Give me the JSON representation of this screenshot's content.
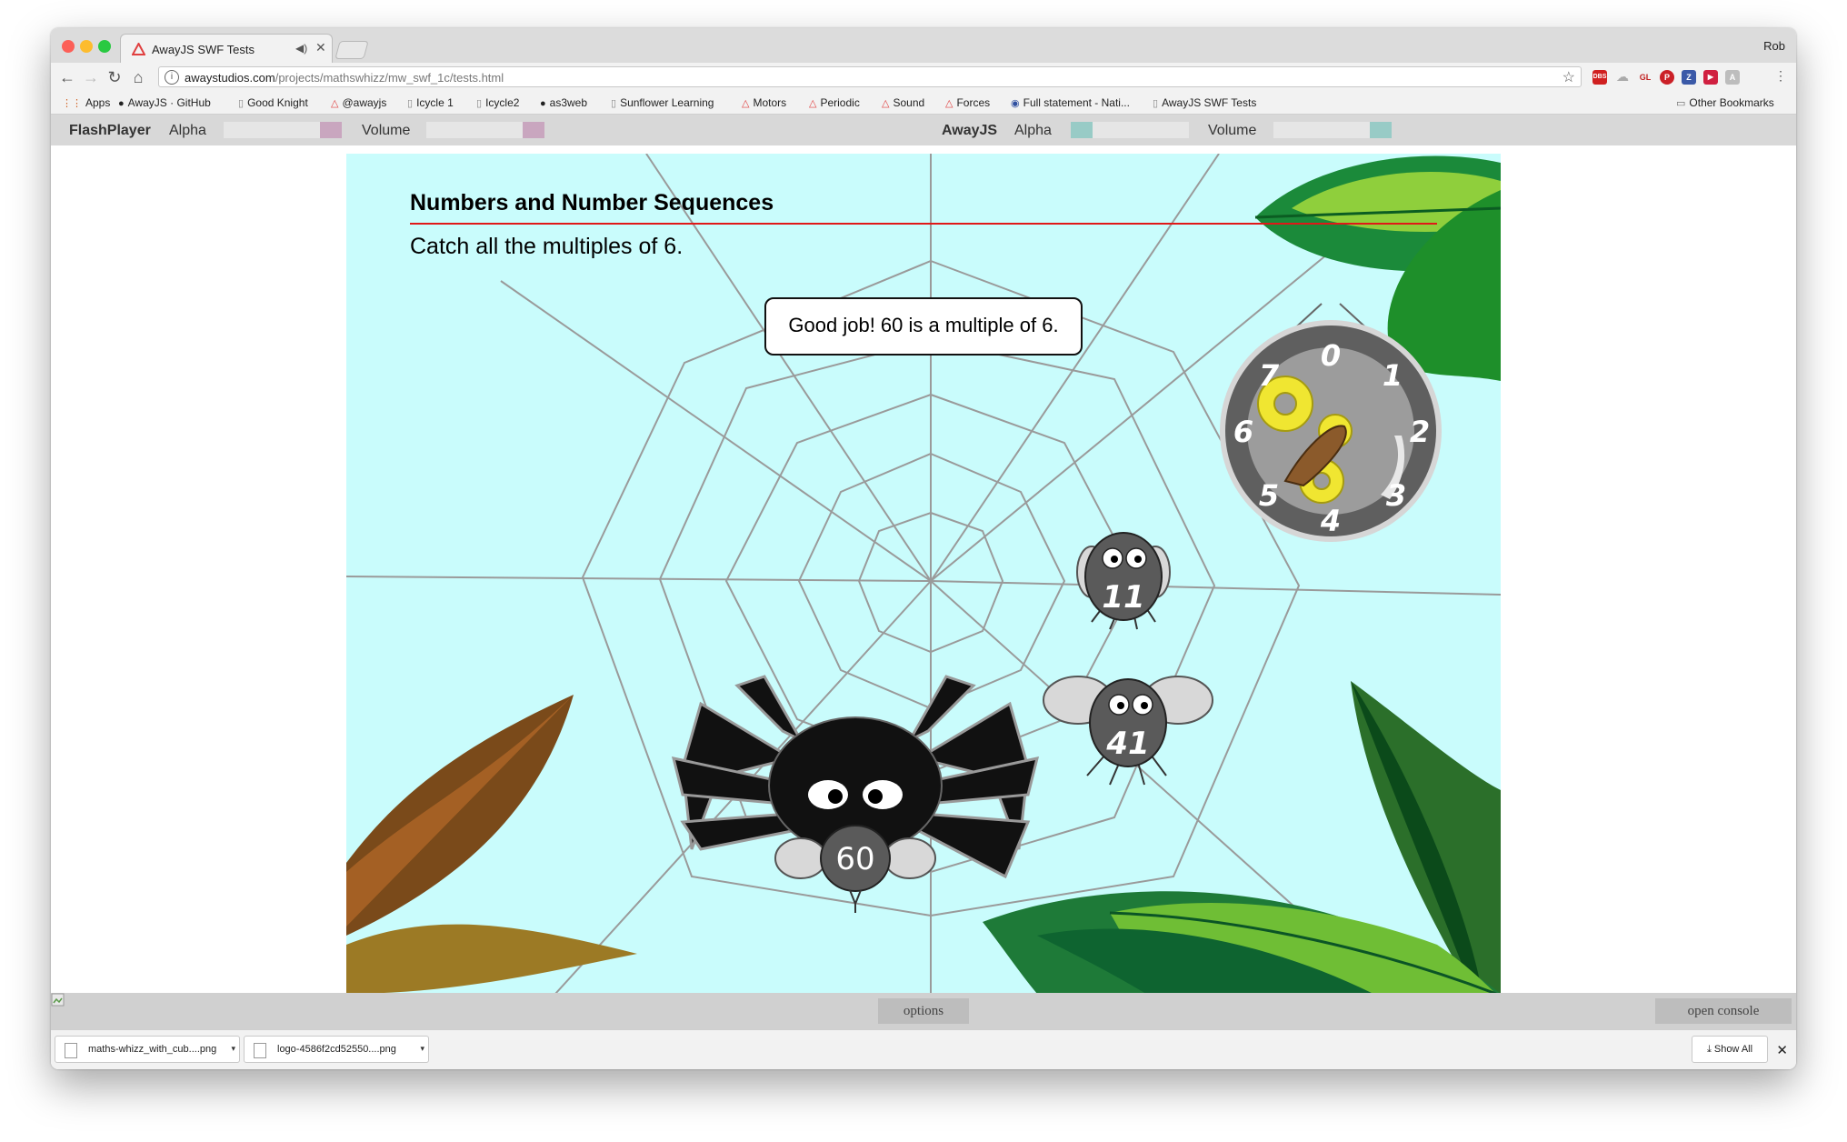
{
  "browser": {
    "tab_title": "AwayJS SWF Tests",
    "user_name": "Rob",
    "url_host": "awaystudios.com",
    "url_path": "/projects/mathswhizz/mw_swf_1c/tests.html",
    "bookmarks": [
      "Apps",
      "AwayJS · GitHub",
      "Good Knight",
      "@awayjs",
      "Icycle 1",
      "Icycle2",
      "as3web",
      "Sunflower Learning",
      "Motors",
      "Periodic",
      "Sound",
      "Forces",
      "Full statement - Nati...",
      "AwayJS SWF Tests"
    ],
    "other_bookmarks": "Other Bookmarks",
    "extensions": [
      "DBS",
      "GL",
      "P",
      "Z",
      "▶",
      "A"
    ]
  },
  "controls": {
    "left_player": "FlashPlayer",
    "right_player": "AwayJS",
    "alpha_label": "Alpha",
    "volume_label": "Volume",
    "flash_alpha": 1.0,
    "flash_volume": 1.0,
    "away_alpha": 0.0,
    "away_volume": 1.0,
    "flash_color": "#c9a6bf",
    "away_color": "#98cbc6"
  },
  "game": {
    "title": "Numbers and Number Sequences",
    "instruction": "Catch all the multiples of 6.",
    "feedback": "Good job!  60 is a multiple of 6.",
    "flies": [
      "11",
      "41"
    ],
    "caught_number": "60",
    "dial_numbers": [
      "0",
      "1",
      "2",
      "3",
      "4",
      "5",
      "6",
      "7"
    ],
    "background_color": "#c9fcfc"
  },
  "footer": {
    "options_label": "options",
    "console_label": "open console"
  },
  "downloads": {
    "items": [
      "maths-whizz_with_cub....png",
      "logo-4586f2cd52550....png"
    ],
    "show_all": "Show All"
  }
}
